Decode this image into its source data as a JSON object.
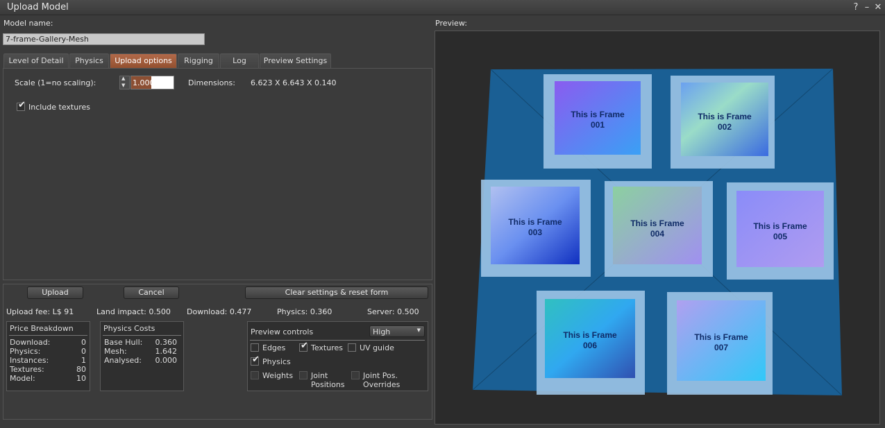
{
  "window": {
    "title": "Upload Model",
    "help": "?",
    "minimize": "–",
    "close": "✕"
  },
  "model_name": {
    "label": "Model name:",
    "value": "7-frame-Gallery-Mesh"
  },
  "preview_label": "Preview:",
  "tabs": [
    {
      "label": "Level of Detail"
    },
    {
      "label": "Physics"
    },
    {
      "label": "Upload options"
    },
    {
      "label": "Rigging"
    },
    {
      "label": "Log"
    },
    {
      "label": "Preview Settings"
    }
  ],
  "upload_options": {
    "scale_label": "Scale (1=no scaling):",
    "scale_value": "1.000",
    "dimensions_label": "Dimensions:",
    "dimensions_value": "6.623 X 6.643 X 0.140",
    "include_textures_label": "Include textures",
    "include_textures_checked": true
  },
  "buttons": {
    "upload": "Upload",
    "cancel": "Cancel",
    "clear": "Clear settings & reset form"
  },
  "summary": {
    "upload_fee": "Upload fee: L$ 91",
    "land_impact": "Land impact: 0.500",
    "download": "Download: 0.477",
    "physics": "Physics: 0.360",
    "server": "Server: 0.500"
  },
  "price_breakdown": {
    "title": "Price Breakdown",
    "rows": [
      {
        "label": "Download:",
        "value": "0"
      },
      {
        "label": "Physics:",
        "value": "0"
      },
      {
        "label": "Instances:",
        "value": "1"
      },
      {
        "label": "Textures:",
        "value": "80"
      },
      {
        "label": "Model:",
        "value": "10"
      }
    ]
  },
  "physics_costs": {
    "title": "Physics Costs",
    "rows": [
      {
        "label": "Base Hull:",
        "value": "0.360"
      },
      {
        "label": "Mesh:",
        "value": "1.642"
      },
      {
        "label": "Analysed:",
        "value": "0.000"
      }
    ]
  },
  "preview_controls": {
    "title": "Preview controls",
    "quality": "High",
    "edges": "Edges",
    "textures": "Textures",
    "uv_guide": "UV guide",
    "physics": "Physics",
    "weights": "Weights",
    "joint_positions_1": "Joint",
    "joint_positions_2": "Positions",
    "joint_overrides_1": "Joint Pos.",
    "joint_overrides_2": "Overrides"
  },
  "frames": [
    {
      "line1": "This is Frame",
      "line2": "001"
    },
    {
      "line1": "This is Frame",
      "line2": "002"
    },
    {
      "line1": "This is Frame",
      "line2": "003"
    },
    {
      "line1": "This is Frame",
      "line2": "004"
    },
    {
      "line1": "This is Frame",
      "line2": "005"
    },
    {
      "line1": "This is Frame",
      "line2": "006"
    },
    {
      "line1": "This is Frame",
      "line2": "007"
    }
  ],
  "colors": {
    "active_tab": "#a35e3d",
    "preview_bg": "#2b2b2b",
    "mesh_blue": "#1a5f94"
  }
}
